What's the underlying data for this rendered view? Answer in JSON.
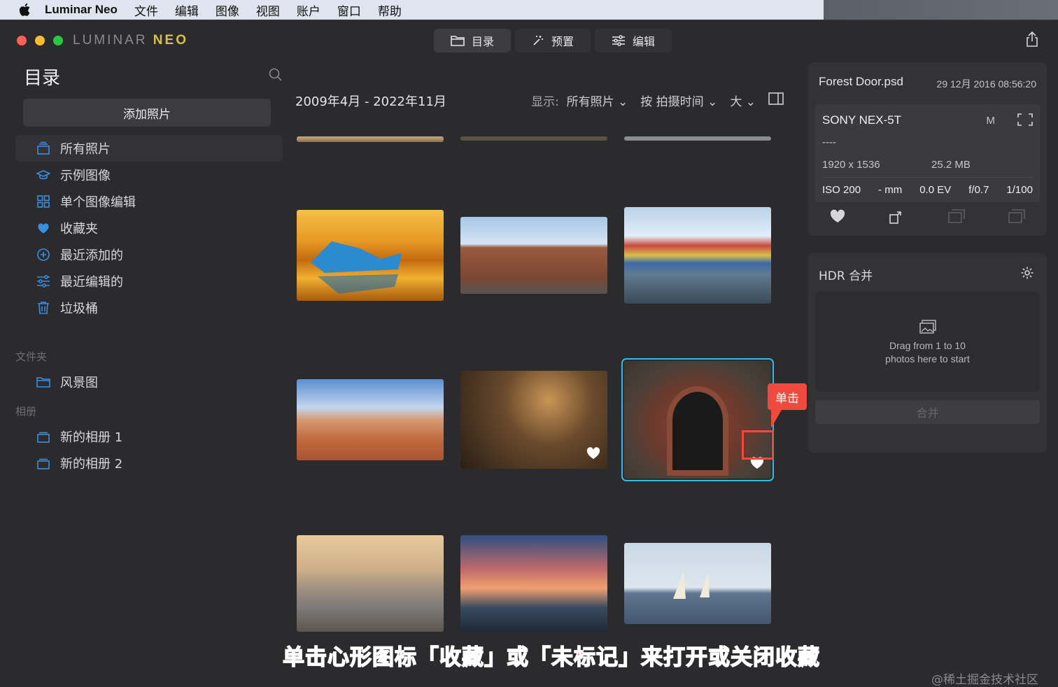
{
  "menubar": {
    "app_name": "Luminar Neo",
    "items": [
      "文件",
      "编辑",
      "图像",
      "视图",
      "账户",
      "窗口",
      "帮助"
    ]
  },
  "logo": {
    "left": "LUMINAR",
    "right": "NEO"
  },
  "topnav": {
    "catalog": "目录",
    "presets": "预置",
    "edit": "编辑"
  },
  "sidebar": {
    "title": "目录",
    "add_button": "添加照片",
    "items": [
      {
        "label": "所有照片",
        "icon": "stack-icon",
        "active": true
      },
      {
        "label": "示例图像",
        "icon": "graduation-cap-icon"
      },
      {
        "label": "单个图像编辑",
        "icon": "grid-icon"
      },
      {
        "label": "收藏夹",
        "icon": "heart-icon"
      },
      {
        "label": "最近添加的",
        "icon": "plus-circle-icon"
      },
      {
        "label": "最近编辑的",
        "icon": "sliders-icon"
      },
      {
        "label": "垃圾桶",
        "icon": "trash-icon"
      }
    ],
    "folders_label": "文件夹",
    "folder": "风景图",
    "albums_label": "相册",
    "albums": [
      "新的相册 1",
      "新的相册 2"
    ]
  },
  "main": {
    "date_range": "2009年4月 - 2022年11月",
    "show_label": "显示:",
    "show_value": "所有照片",
    "sort_value": "按 拍摄时间",
    "size_value": "大"
  },
  "info": {
    "filename": "Forest Door.psd",
    "datetime": "29 12月 2016 08:56:20",
    "camera": "SONY NEX-5T",
    "mode": "M",
    "lens": "----",
    "resolution": "1920 x 1536",
    "filesize": "25.2 MB",
    "iso": "ISO 200",
    "focal": "- mm",
    "ev": "0.0 EV",
    "aperture": "f/0.7",
    "shutter": "1/100"
  },
  "hdr": {
    "title": "HDR 合并",
    "drop_line1": "Drag from 1 to 10",
    "drop_line2": "photos here to start",
    "merge_button": "合并"
  },
  "annotation": {
    "callout": "单击",
    "caption": "单击心形图标「收藏」或「未标记」来打开或关闭收藏",
    "watermark": "@稀土掘金技术社区"
  },
  "colors": {
    "accent": "#36b9e6",
    "callout": "#f04a3f",
    "icon_blue": "#3a8fe0"
  }
}
